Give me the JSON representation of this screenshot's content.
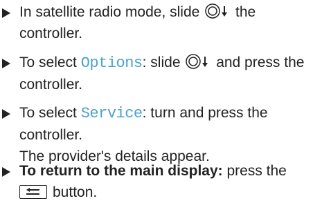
{
  "steps": [
    {
      "pre": "In satellite radio mode, slide",
      "post": "the controller."
    },
    {
      "pre": "To select",
      "option": "Options",
      "mid": ": slide",
      "post": "and press the controller."
    },
    {
      "pre": "To select",
      "option": "Service",
      "mid": ": turn and press the controller.",
      "result": "The provider's details appear."
    },
    {
      "bold": "To return to the main display:",
      "mid": "press the",
      "post": "button."
    }
  ],
  "icons": {
    "bullet": "triangle-bullet-icon",
    "controller_slide_down": "controller-slide-down-icon",
    "back_button": "back-button-icon"
  }
}
